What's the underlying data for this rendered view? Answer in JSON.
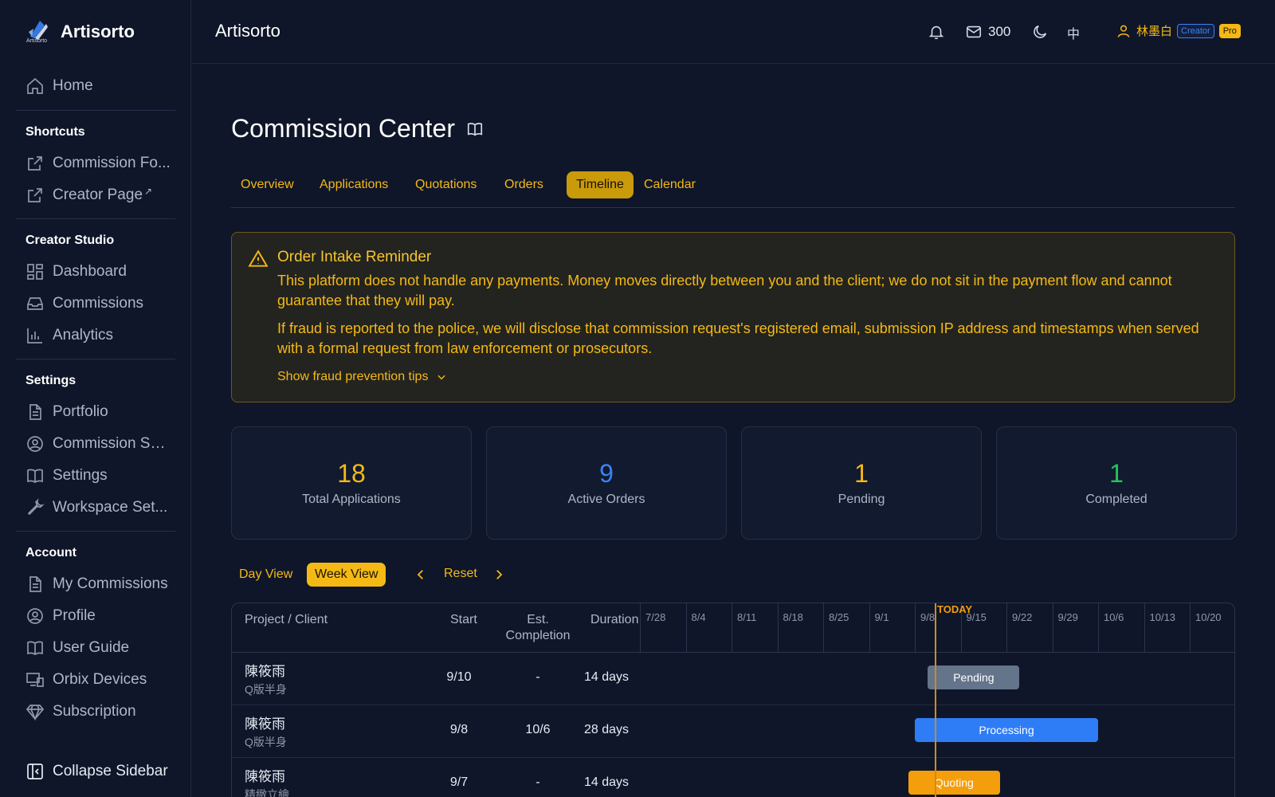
{
  "brand": {
    "name": "Artisorto",
    "logo_caption": "Artisorto"
  },
  "sidebar": {
    "home": {
      "label": "Home",
      "icon": "home-icon"
    },
    "shortcuts": {
      "title": "Shortcuts",
      "items": [
        {
          "label": "Commission Fo...",
          "icon": "external-link-icon"
        },
        {
          "label": "Creator Page",
          "icon": "external-link-icon",
          "mark": "↗"
        }
      ]
    },
    "creator_studio": {
      "title": "Creator Studio",
      "items": [
        {
          "label": "Dashboard",
          "icon": "dashboard-icon"
        },
        {
          "label": "Commissions",
          "icon": "inbox-icon"
        },
        {
          "label": "Analytics",
          "icon": "bar-chart-icon"
        }
      ]
    },
    "settings": {
      "title": "Settings",
      "items": [
        {
          "label": "Portfolio",
          "icon": "document-icon"
        },
        {
          "label": "Commission Se...",
          "icon": "user-circle-icon"
        },
        {
          "label": "Settings",
          "icon": "book-icon"
        },
        {
          "label": "Workspace Set...",
          "icon": "wrench-icon"
        }
      ]
    },
    "account": {
      "title": "Account",
      "items": [
        {
          "label": "My Commissions",
          "icon": "document-icon"
        },
        {
          "label": "Profile",
          "icon": "user-circle-icon"
        },
        {
          "label": "User Guide",
          "icon": "book-icon"
        },
        {
          "label": "Orbix Devices",
          "icon": "devices-icon"
        },
        {
          "label": "Subscription",
          "icon": "diamond-icon"
        }
      ]
    },
    "collapse": {
      "label": "Collapse Sidebar",
      "icon": "sidebar-collapse-icon"
    }
  },
  "topbar": {
    "title": "Artisorto",
    "mail_count": "300",
    "lang": "中",
    "user_name": "林墨白",
    "badge_creator": "Creator",
    "badge_pro": "Pro"
  },
  "page": {
    "title": "Commission Center",
    "tabs": [
      "Overview",
      "Applications",
      "Quotations",
      "Orders",
      "Timeline",
      "Calendar"
    ],
    "active_tab": "Timeline"
  },
  "notice": {
    "title": "Order Intake Reminder",
    "p1": "This platform does not handle any payments. Money moves directly between you and the client; we do not sit in the payment flow and cannot guarantee that they will pay.",
    "p2": "If fraud is reported to the police, we will disclose that commission request's registered email, submission IP address and timestamps when served with a formal request from law enforcement or prosecutors.",
    "toggle": "Show fraud prevention tips"
  },
  "stats": [
    {
      "value": "18",
      "label": "Total Applications",
      "color": "#f5b915"
    },
    {
      "value": "9",
      "label": "Active Orders",
      "color": "#3b82f6"
    },
    {
      "value": "1",
      "label": "Pending",
      "color": "#f5b915"
    },
    {
      "value": "1",
      "label": "Completed",
      "color": "#22c55e"
    }
  ],
  "view": {
    "day": "Day View",
    "week": "Week View",
    "active": "Week View",
    "reset": "Reset"
  },
  "gantt": {
    "columns": {
      "project": "Project / Client",
      "start": "Start",
      "est_line1": "Est.",
      "est_line2": "Completion",
      "duration": "Duration"
    },
    "weeks": [
      "7/28",
      "8/4",
      "8/11",
      "8/18",
      "8/25",
      "9/1",
      "9/8",
      "9/15",
      "9/22",
      "9/29",
      "10/6",
      "10/13",
      "10/20"
    ],
    "today_label": "TODAY",
    "rows": [
      {
        "client": "陳筱雨",
        "project": "Q版半身",
        "start": "9/10",
        "est": "-",
        "duration": "14 days",
        "status": "Pending",
        "color": "#64748b"
      },
      {
        "client": "陳筱雨",
        "project": "Q版半身",
        "start": "9/8",
        "est": "10/6",
        "duration": "28 days",
        "status": "Processing",
        "color": "#2f7df6"
      },
      {
        "client": "陳筱雨",
        "project": "精緻立繪",
        "start": "9/7",
        "est": "-",
        "duration": "14 days",
        "status": "Quoting",
        "color": "#f59e0b"
      }
    ]
  }
}
